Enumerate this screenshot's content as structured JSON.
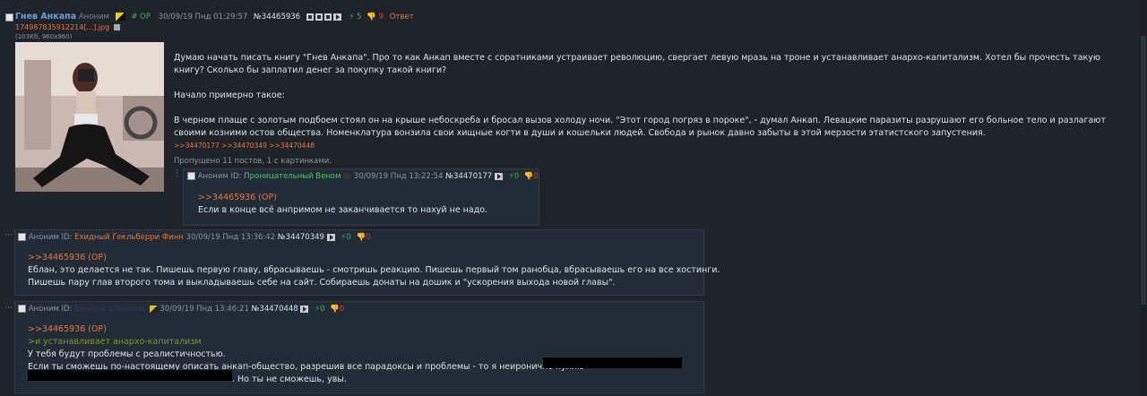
{
  "op": {
    "author": "Гнев Анкапа",
    "anon": "Аноним",
    "op_tag": "# OP",
    "datetime": "30/09/19 Пнд 01:29:57",
    "post_no": "№34465936",
    "likes": "5",
    "dislikes": "9",
    "reply_label": "Ответ",
    "file_name": "17498783591221​4[...].jpg",
    "file_info": "(103Кб, 960x960)",
    "text_p1": "Думаю начать писать книгу \"Гнев Анкапа\". Про то как Анкап вместе с соратниками устраивает революцию, свергает левую мразь на троне и устанавливает анархо-капитализм. Хотел бы прочесть такую книгу? Сколько бы заплатил денег за покупку такой книги?",
    "text_p2": "Начало примерно такое:",
    "text_p3": "В черном плаще с золотым подбоем стоял он на крыше небоскреба и бросал вызов холоду ночи. \"Этот город погряз в пороке\", - думал Анкап. Левацкие паразиты разрушают его больное тело и разлагают своими козними остов общества. Номенклатура вонзила свои хищные когти в души и кошельки людей. Свобода и рынок давно забыты в этой мерзости этатистского запустения.",
    "replies_links": ">>34470177 >>34470349 >>34470448",
    "skipped": "Пропущено 11 постов, 1 с картинками."
  },
  "r1": {
    "anon": "Аноним ID:",
    "id_name": "Проницательный Веном",
    "datetime": "30/09/19 Пнд 13:22:54",
    "post_no": "№34470177",
    "likes": "0",
    "dislikes": "0",
    "quote": ">>34465936 (OP)",
    "text": "Если в конце всё анпримом не заканчивается то нахуй не надо."
  },
  "r2": {
    "anon": "Аноним ID:",
    "id_name": "Ехидный Гекльберри Финн",
    "datetime": "30/09/19 Пнд 13:36:42",
    "post_no": "№34470349",
    "likes": "0",
    "dislikes": "0",
    "quote": ">>34465936 (OP)",
    "text_l1": "Еблан, это делается не так. Пишешь первую главу, вбрасываешь - смотришь реакцию. Пишешь первый том ранобца, вбрасываешь его на все хостинги.",
    "text_l2": "Пишешь пару глав второго тома и выкладываешь себе на сайт. Собираешь донаты на дошик и \"ускорения выхода новой главы\"."
  },
  "r3": {
    "anon": "Аноним ID:",
    "id_name": "Ежедки Шершень",
    "datetime": "30/09/19 Пнд 13:46:21",
    "post_no": "№34470448",
    "likes": "0",
    "dislikes": "0",
    "quote": ">>34465936 (OP)",
    "greentext": ">и устанавливает анархо-капитализм",
    "text_l1": "У тебя будут проблемы с реалистичностью.",
    "text_l2": "Если ты сможешь по-настоящему описать анкап-общество, разрешив все парадоксы и проблемы - то я неиронично куплю",
    "text_l3": ". Но ты не сможешь, увы."
  },
  "colors": {
    "bg": "#1f242b",
    "reply_bg": "#212c37",
    "accent": "#e8743b",
    "green": "#39b54a",
    "red": "#d83a3a",
    "link_blue": "#6c9fd8"
  }
}
